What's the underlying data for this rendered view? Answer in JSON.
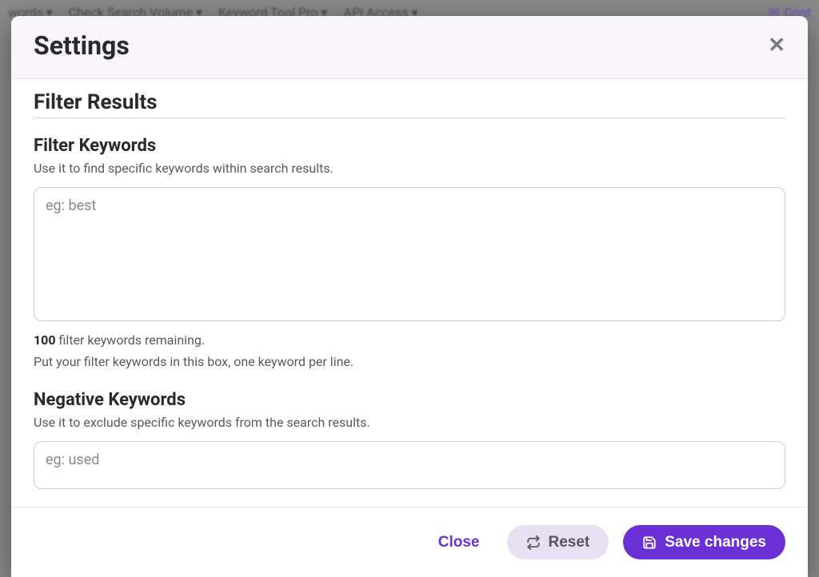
{
  "backgroundNav": {
    "items": [
      "words ▾",
      "Check Search Volume ▾",
      "Keyword Tool Pro ▾",
      "API Access ▾"
    ],
    "rightLabel": "Cont"
  },
  "modal": {
    "title": "Settings",
    "section_title": "Filter Results",
    "filter": {
      "label": "Filter Keywords",
      "desc": "Use it to find specific keywords within search results.",
      "placeholder": "eg: best",
      "value": "",
      "remaining_count": "100",
      "remaining_text": " filter keywords remaining.",
      "hint": "Put your filter keywords in this box, one keyword per line."
    },
    "negative": {
      "label": "Negative Keywords",
      "desc": "Use it to exclude specific keywords from the search results.",
      "placeholder": "eg: used",
      "value": ""
    },
    "footer": {
      "close": "Close",
      "reset": "Reset",
      "save": "Save changes"
    }
  }
}
